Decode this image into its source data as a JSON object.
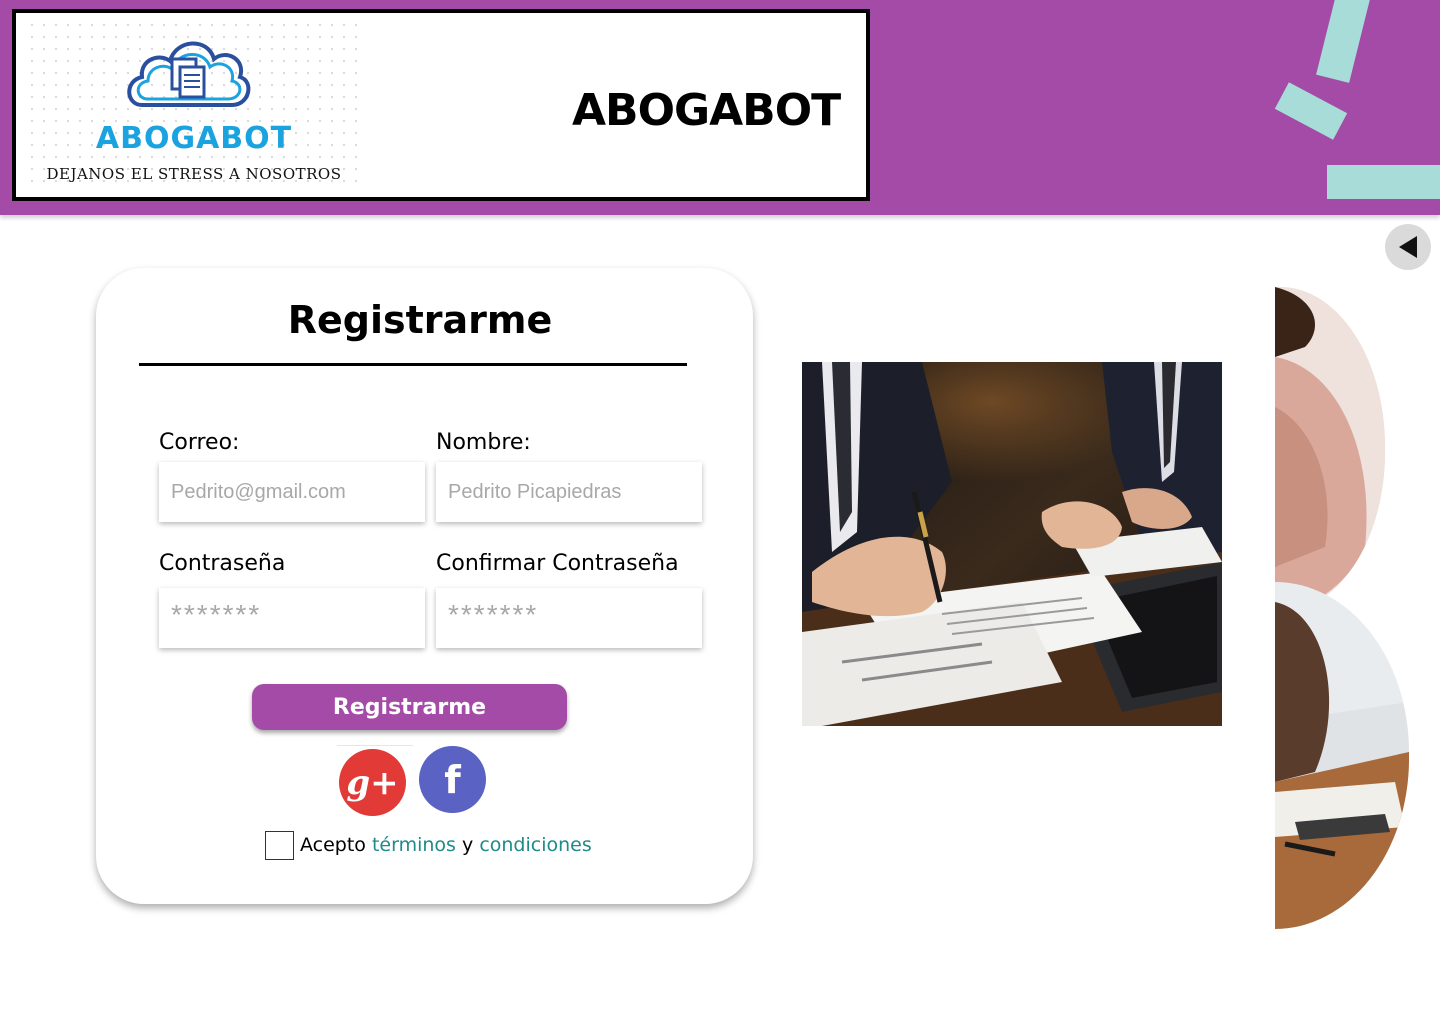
{
  "header": {
    "logo_name": "ABOGABOT",
    "logo_tagline": "DEJANOS EL STRESS A NOSOTROS",
    "brand_title": "ABOGABOT"
  },
  "colors": {
    "brand_purple": "#a34ba6",
    "accent_teal": "#a8dcd8",
    "logo_blue": "#1ba3e0",
    "link_teal": "#1f8a8a",
    "google_red": "#e23a36",
    "facebook_blue": "#5a62c4"
  },
  "nav": {
    "back_icon": "triangle-left-icon"
  },
  "form": {
    "title": "Registrarme",
    "email_label": "Correo:",
    "email_placeholder": "Pedrito@gmail.com",
    "name_label": "Nombre:",
    "name_placeholder": "Pedrito Picapiedras",
    "password_label": "Contraseña",
    "password_placeholder": "*******",
    "confirm_label": "Confirmar Contraseña",
    "confirm_placeholder": "*******",
    "submit_label": "Registrarme",
    "google_glyph": "g+",
    "facebook_glyph": "f",
    "terms_prefix": "Acepto",
    "terms_link1": "términos",
    "terms_joiner": "y",
    "terms_link2": "condiciones"
  }
}
